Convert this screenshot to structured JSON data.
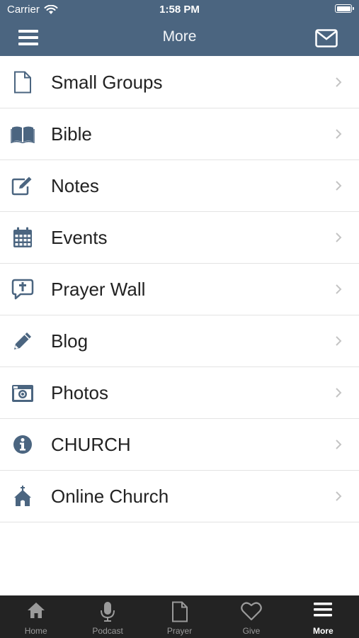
{
  "status_bar": {
    "carrier": "Carrier",
    "time": "1:58 PM"
  },
  "header": {
    "title": "More",
    "menu_icon": "hamburger-menu-icon",
    "mail_icon": "envelope-icon"
  },
  "colors": {
    "header_bg": "#4b6580",
    "icon_color": "#4b6580",
    "tabbar_bg": "#232323"
  },
  "menu_items": [
    {
      "label": "Small Groups",
      "icon": "document-icon"
    },
    {
      "label": "Bible",
      "icon": "open-book-icon"
    },
    {
      "label": "Notes",
      "icon": "edit-note-icon"
    },
    {
      "label": "Events",
      "icon": "calendar-icon"
    },
    {
      "label": "Prayer Wall",
      "icon": "prayer-bubble-icon"
    },
    {
      "label": "Blog",
      "icon": "pencil-icon"
    },
    {
      "label": "Photos",
      "icon": "camera-icon"
    },
    {
      "label": "CHURCH",
      "icon": "info-icon"
    },
    {
      "label": "Online Church",
      "icon": "church-icon"
    }
  ],
  "tabs": [
    {
      "label": "Home",
      "icon": "home-icon"
    },
    {
      "label": "Podcast",
      "icon": "microphone-icon"
    },
    {
      "label": "Prayer",
      "icon": "document-icon"
    },
    {
      "label": "Give",
      "icon": "heart-icon"
    },
    {
      "label": "More",
      "icon": "more-icon",
      "active": true
    }
  ]
}
